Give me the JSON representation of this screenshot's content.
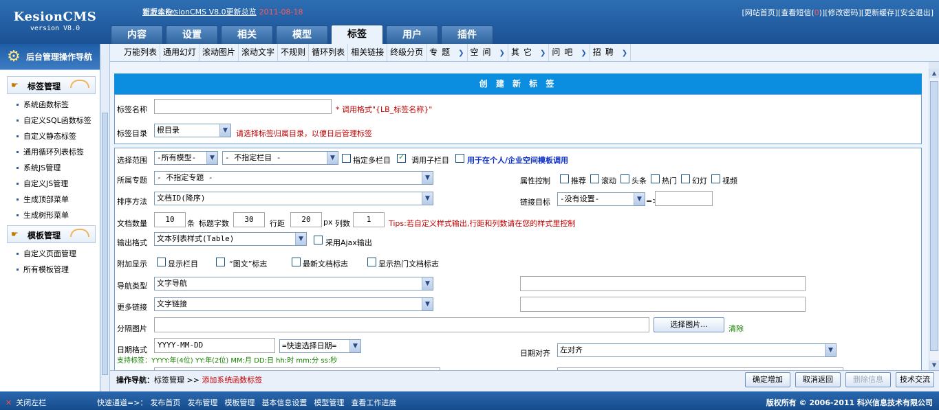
{
  "header": {
    "logo_title": "KesionCMS",
    "logo_version": "version V8.0",
    "notice_label": "官方公告：",
    "notice_text": "新版本KesionCMS V8.0更新总览",
    "notice_date": "2011-08-18",
    "links": {
      "home": "[网站首页]",
      "msg_prefix": "[查看短信(",
      "msg_count": "0",
      "msg_suffix": ")]",
      "password": "[修改密码]",
      "cache": "[更新缓存]",
      "logout": "[安全退出]"
    },
    "tabs": [
      "内容",
      "设置",
      "相关",
      "模型",
      "标签",
      "用户",
      "插件"
    ],
    "active_tab": "标签"
  },
  "sidebar": {
    "title": "后台管理操作导航",
    "sections": [
      {
        "title": "标签管理",
        "items": [
          "系统函数标签",
          "自定义SQL函数标签",
          "自定义静态标签",
          "通用循环列表标签",
          "系统JS管理",
          "自定义JS管理",
          "生成顶部菜单",
          "生成树形菜单"
        ]
      },
      {
        "title": "模板管理",
        "items": [
          "自定义页面管理",
          "所有模板管理"
        ]
      }
    ]
  },
  "subnav": {
    "items": [
      "万能列表",
      "通用幻灯",
      "滚动图片",
      "滚动文字",
      "不规则",
      "循环列表",
      "相关链接",
      "终级分页"
    ],
    "dropdowns": [
      "专题",
      "空间",
      "其它",
      "问吧",
      "招聘"
    ]
  },
  "form": {
    "title": "创 建 新 标 签",
    "name_label": "标签名称",
    "name_value": "",
    "name_hint": "* 调用格式\"{LB_标签名称}\"",
    "dir_label": "标签目录",
    "dir_value": "根目录",
    "dir_hint": "请选择标签归属目录，以便日后管理标签",
    "scope_label": "选择范围",
    "model_value": "-所有模型-",
    "column_value": "- 不指定栏目 -",
    "multi_col_label": "指定多栏目",
    "sub_col_label": "调用子栏目",
    "space_label": "用于在个人/企业空间模板调用",
    "topic_label": "所属专题",
    "topic_value": "- 不指定专题 -",
    "attr_label": "属性控制",
    "attrs": [
      "推荐",
      "滚动",
      "头条",
      "热门",
      "幻灯",
      "视频"
    ],
    "sort_label": "排序方法",
    "sort_value": "文档ID(降序)",
    "target_label": "链接目标",
    "target_value": "-没有设置-",
    "target_arrow": "=>",
    "target_input": "",
    "count_label": "文档数量",
    "count_value": "10",
    "count_unit": "条",
    "chars_label": "标题字数",
    "chars_value": "30",
    "rowgap_label": "行距",
    "rowgap_value": "20",
    "rowgap_unit": "px",
    "cols_label": "列数",
    "cols_value": "1",
    "tips": "Tips:若自定义样式输出,行距和列数请在您的样式里控制",
    "output_label": "输出格式",
    "output_value": "文本列表样式(Table)",
    "ajax_label": "采用Ajax输出",
    "extra_label": "附加显示",
    "extras": [
      "显示栏目",
      "“图文”标志",
      "最新文档标志",
      "显示热门文档标志"
    ],
    "navtype_label": "导航类型",
    "navtype_value": "文字导航",
    "navtype_input": "",
    "more_label": "更多链接",
    "more_value": "文字链接",
    "more_input": "",
    "sep_label": "分隔图片",
    "sep_value": "",
    "choose_btn": "选择图片...",
    "clear_label": "清除",
    "date_label": "日期格式",
    "date_value": "YYYY-MM-DD",
    "date_quick": "=快速选择日期=",
    "date_support": "支持标签：YYYY:年(4位) YY:年(2位) MM:月 DD:日 hh:时 mm:分 ss:秒",
    "align_label": "日期对齐",
    "align_value": "左对齐"
  },
  "opbar": {
    "prefix": "操作导航：",
    "crumb": "标签管理",
    "sep": ">>",
    "current": "添加系统函数标签",
    "buttons": [
      "确定增加",
      "取消返回",
      "删除信息",
      "技术交流"
    ]
  },
  "footer": {
    "close": "关闭左栏",
    "quick_label": "快速通道=>：",
    "quick_links": [
      "发布首页",
      "发布管理",
      "模板管理",
      "基本信息设置",
      "模型管理",
      "查看工作进度"
    ],
    "copyright": "版权所有 © 2006-2011 科兴信息技术有限公司"
  }
}
